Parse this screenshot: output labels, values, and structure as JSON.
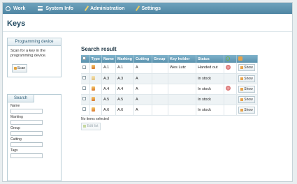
{
  "nav": {
    "items": [
      {
        "label": "Work",
        "icon": "clock-icon"
      },
      {
        "label": "System Info",
        "icon": "list-icon"
      },
      {
        "label": "Administration",
        "icon": "pen-icon"
      },
      {
        "label": "Settings",
        "icon": "wrench-icon"
      }
    ]
  },
  "page": {
    "title": "Keys"
  },
  "programming": {
    "header": "Programming device",
    "text": "Scan for a key in the programming device.",
    "scan_label": "Scan"
  },
  "search": {
    "tab_label": "Search",
    "fields": [
      {
        "label": "Name",
        "value": ""
      },
      {
        "label": "Marking",
        "value": ""
      },
      {
        "label": "Group",
        "value": ""
      },
      {
        "label": "Cutting",
        "value": ""
      },
      {
        "label": "Tags",
        "value": ""
      }
    ]
  },
  "results": {
    "title": "Search result",
    "columns": [
      "Type",
      "Name",
      "Marking",
      "Cutting",
      "Group",
      "Key holder",
      "Status"
    ],
    "rows": [
      {
        "name": "A.1",
        "marking": "A.1",
        "cutting": "A",
        "group": "",
        "holder": "Wes Lutz",
        "status": "Handed out",
        "warn": true
      },
      {
        "name": "A.3",
        "marking": "A.3",
        "cutting": "A",
        "group": "",
        "holder": "",
        "status": "In stock",
        "warn": false
      },
      {
        "name": "A.4",
        "marking": "A.4",
        "cutting": "A",
        "group": "",
        "holder": "",
        "status": "In stock",
        "warn": true
      },
      {
        "name": "A.5",
        "marking": "A.5",
        "cutting": "A",
        "group": "",
        "holder": "",
        "status": "In stock",
        "warn": false
      },
      {
        "name": "A.6",
        "marking": "A.6",
        "cutting": "A",
        "group": "",
        "holder": "",
        "status": "In stock",
        "warn": false
      }
    ],
    "show_label": "Show",
    "no_items_text": "No items selected",
    "edit_label": "Edit list"
  },
  "colors": {
    "topbar": "#5a91ad",
    "accent": "#e7a34a"
  }
}
